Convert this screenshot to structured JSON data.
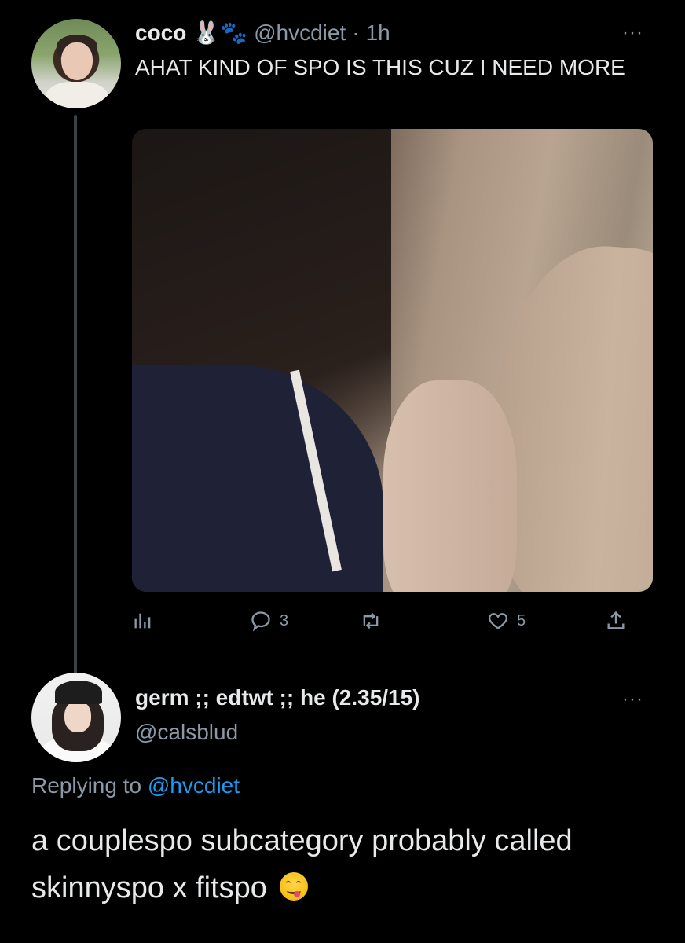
{
  "parent_tweet": {
    "display_name": "coco",
    "name_emojis": "🐰🐾",
    "handle": "@hvcdiet",
    "separator": "·",
    "time": "1h",
    "text": "AHAT KIND OF SPO IS THIS CUZ I NEED MORE",
    "more_icon": "···",
    "actions": {
      "reply_count": "3",
      "retweet_count": "",
      "like_count": "5"
    }
  },
  "reply_tweet": {
    "display_name": "germ ;; edtwt ;; he (2.35/15)",
    "handle": "@calsblud",
    "more_icon": "···",
    "replying_prefix": "Replying to",
    "replying_to": "@hvcdiet",
    "text": "a couplespo subcategory probably called skinnyspo x fitspo"
  },
  "colors": {
    "background": "#000000",
    "text_primary": "#e7e9ea",
    "text_secondary": "#8b98a5",
    "link": "#1d9bf0"
  }
}
